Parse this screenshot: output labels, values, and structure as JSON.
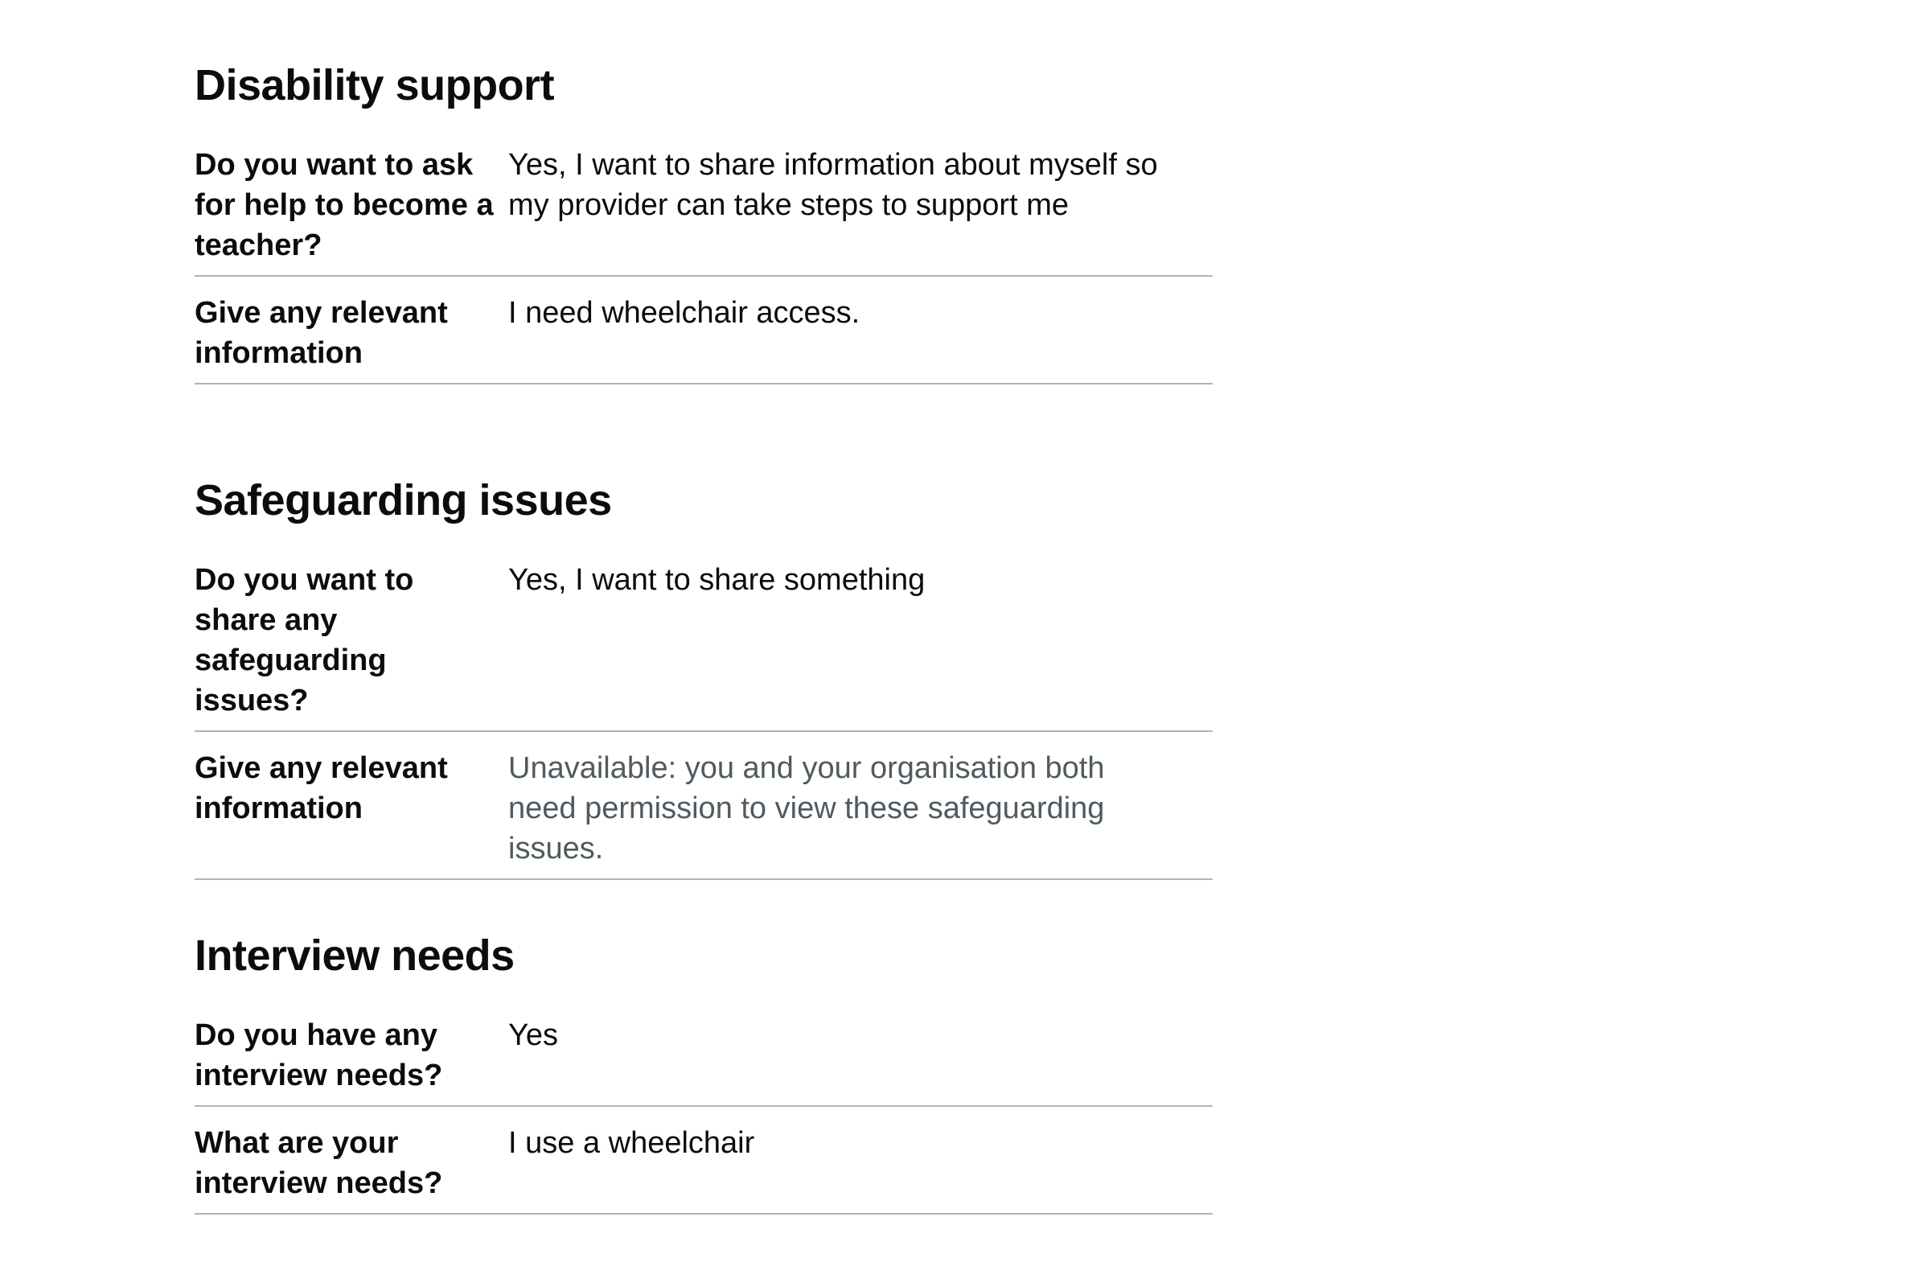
{
  "sections": [
    {
      "heading": "Disability support",
      "rows": [
        {
          "key": "Do you want to ask for help to become a teacher?",
          "value": "Yes, I want to share information about myself so my provider can take steps to support me"
        },
        {
          "key": "Give any relevant information",
          "value": "I need wheelchair access."
        }
      ]
    },
    {
      "heading": "Safeguarding issues",
      "rows": [
        {
          "key": "Do you want to share any safeguarding issues?",
          "value": "Yes, I want to share something"
        },
        {
          "key": "Give any relevant information",
          "value": "Unavailable: you and your organisation both need permission to view these safeguarding issues."
        }
      ]
    },
    {
      "heading": "Interview needs",
      "rows": [
        {
          "key": "Do you have any interview needs?",
          "value": "Yes"
        },
        {
          "key": "What are your interview needs?",
          "value": "I use a wheelchair"
        }
      ]
    }
  ],
  "colors": {
    "text": "#0b0c0c",
    "muted_text": "#505a5f",
    "border": "#b1b4b6",
    "background": "#ffffff"
  }
}
